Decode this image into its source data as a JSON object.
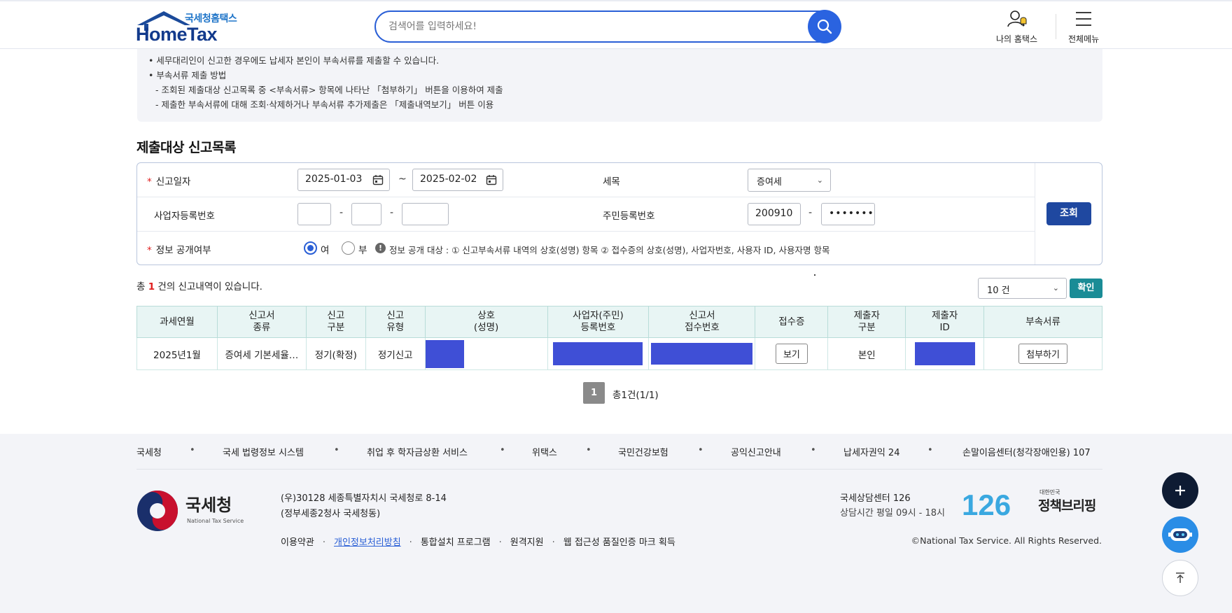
{
  "header": {
    "logo_small": "국세청홈택스",
    "logo_big": "HomeTax",
    "search_placeholder": "검색어를 입력하세요!",
    "my_hometax": "나의 홈택스",
    "all_menu": "전체메뉴"
  },
  "notice": {
    "lines": [
      "• 세무대리인이 신고한 경우에도 납세자 본인이 부속서류를 제출할 수 있습니다.",
      "• 부속서류 제출 방법",
      "- 조회된 제출대상 신고목록 중 <부속서류> 항목에 나타난 「첨부하기」 버튼을 이용하여 제출",
      "- 제출한 부속서류에 대해 조회·삭제하거나 부속서류 추가제출은 「제출내역보기」 버튼 이용"
    ]
  },
  "section_title": "제출대상 신고목록",
  "form": {
    "date_label": "신고일자",
    "date_from": "2025-01-03",
    "date_sep": "~",
    "date_to": "2025-02-02",
    "tax_item_label": "세목",
    "tax_item_value": "증여세",
    "biz_no_label": "사업자등록번호",
    "biz_sep": "-",
    "resident_no_label": "주민등록번호",
    "resident_front": "200910",
    "resident_back": "•••••••",
    "disclosure_label": "정보 공개여부",
    "yes": "여",
    "no": "부",
    "info_icon": "!",
    "info_text": "정보 공개 대상 : ① 신고부속서류 내역의 상호(성명) 항목 ② 접수증의 상호(성명), 사업자번호, 사용자 ID, 사용자명 항목",
    "search_button": "조회"
  },
  "result": {
    "count_prefix": "총",
    "count": "1",
    "count_suffix": "건의 신고내역이 있습니다.",
    "page_size": "10 건",
    "confirm_button": "확인"
  },
  "table": {
    "headers": [
      [
        "과세연월"
      ],
      [
        "신고서",
        "종류"
      ],
      [
        "신고",
        "구분"
      ],
      [
        "신고",
        "유형"
      ],
      [
        "상호",
        "(성명)"
      ],
      [
        "사업자(주민)",
        "등록번호"
      ],
      [
        "신고서",
        "접수번호"
      ],
      [
        "접수증"
      ],
      [
        "제출자",
        "구분"
      ],
      [
        "제출자",
        "ID"
      ],
      [
        "부속서류"
      ]
    ],
    "rows": [
      {
        "period": "2025년1월",
        "form_type": "증여세 기본세율…",
        "report_class": "정기(확정)",
        "report_type": "정기신고",
        "receipt_button": "보기",
        "submitter_type": "본인",
        "attach_button": "첨부하기"
      }
    ]
  },
  "pagination": {
    "current": "1",
    "total_text": "총1건(1/1)"
  },
  "footer": {
    "links": [
      "국세청",
      "국세 법령정보 시스템",
      "취업 후 학자금상환 서비스",
      "위택스",
      "국민건강보험",
      "공익신고안내",
      "납세자권익 24",
      "손말이음센터(청각장애인용) 107"
    ],
    "org_name": "국세청",
    "org_name_en": "National Tax Service",
    "address_line1": "(우)30128 세종특별자치시 국세청로 8-14",
    "address_line2": "(정부세종2청사 국세청동)",
    "bottom_links": [
      "이용약관",
      "개인정보처리방침",
      "통합설치 프로그램",
      "원격지원",
      "웹 접근성 품질인증 마크 획득"
    ],
    "center_title": "국세상담센터 126",
    "center_hours": "상담시간 평일 09시 - 18시",
    "badge_number": "126",
    "briefing_small": "대한민국",
    "briefing_big": "정책브리핑",
    "copyright": "©National Tax Service. All Rights Reserved."
  },
  "colors": {
    "primary": "#2a5fd6",
    "dark_blue": "#1f48a0",
    "teal": "#1a8c96",
    "mask": "#3f4fd6",
    "required": "#e02020"
  }
}
